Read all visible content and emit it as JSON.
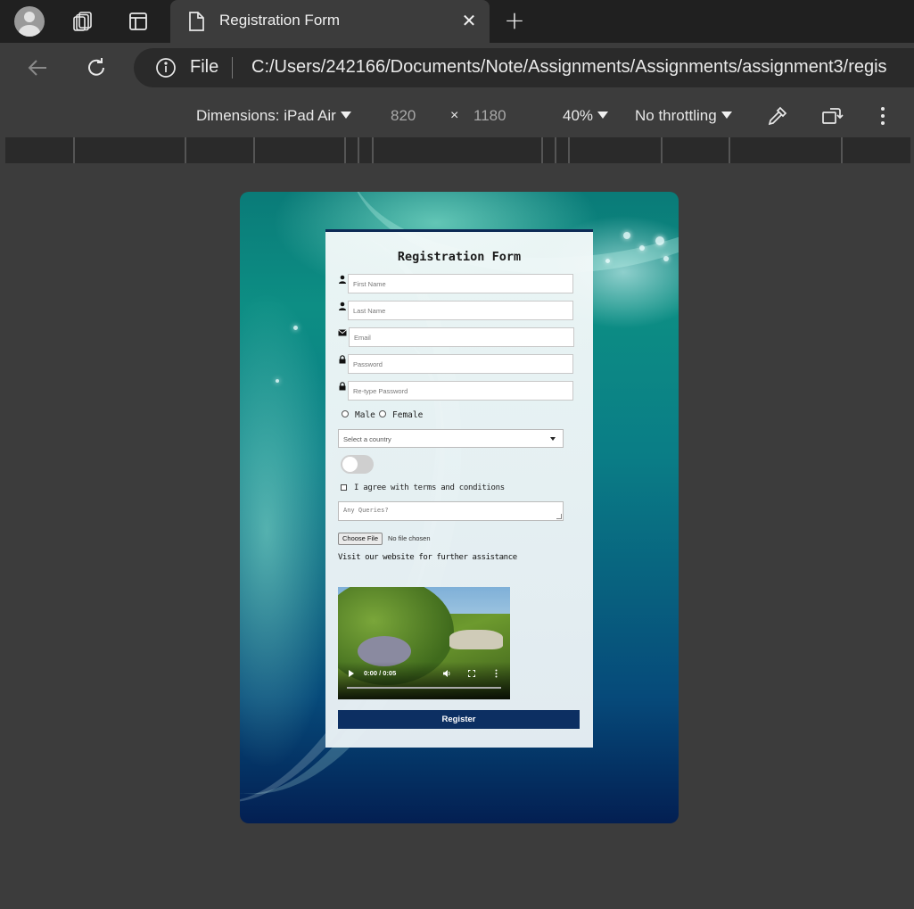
{
  "browser": {
    "tab": {
      "title": "Registration Form",
      "icon": "document-icon"
    },
    "address": {
      "scheme_label": "File",
      "url": "C:/Users/242166/Documents/Note/Assignments/Assignments/assignment3/regis"
    }
  },
  "device_toolbar": {
    "dimensions_label": "Dimensions: iPad Air",
    "width": "820",
    "times": "×",
    "height": "1180",
    "zoom": "40%",
    "throttling": "No throttling"
  },
  "form": {
    "title": "Registration Form",
    "fields": [
      {
        "placeholder": "First Name",
        "icon": "user-icon"
      },
      {
        "placeholder": "Last Name",
        "icon": "user-icon"
      },
      {
        "placeholder": "Email",
        "icon": "envelope-icon"
      },
      {
        "placeholder": "Password",
        "icon": "lock-icon"
      },
      {
        "placeholder": "Re-type Password",
        "icon": "lock-icon"
      }
    ],
    "gender": {
      "male": "Male",
      "female": "Female"
    },
    "country": {
      "selected": "Select a country"
    },
    "toggle_on": false,
    "terms_label": "I agree with terms and conditions",
    "queries_placeholder": "Any Queries?",
    "file": {
      "button": "Choose File",
      "status": "No file chosen"
    },
    "visit_text": "Visit our website for further assistance",
    "video": {
      "time": "0:00 / 0:05"
    },
    "register_label": "Register"
  },
  "colors": {
    "accent": "#0c2f62",
    "chrome_dark": "#202020",
    "chrome": "#3c3c3c"
  }
}
